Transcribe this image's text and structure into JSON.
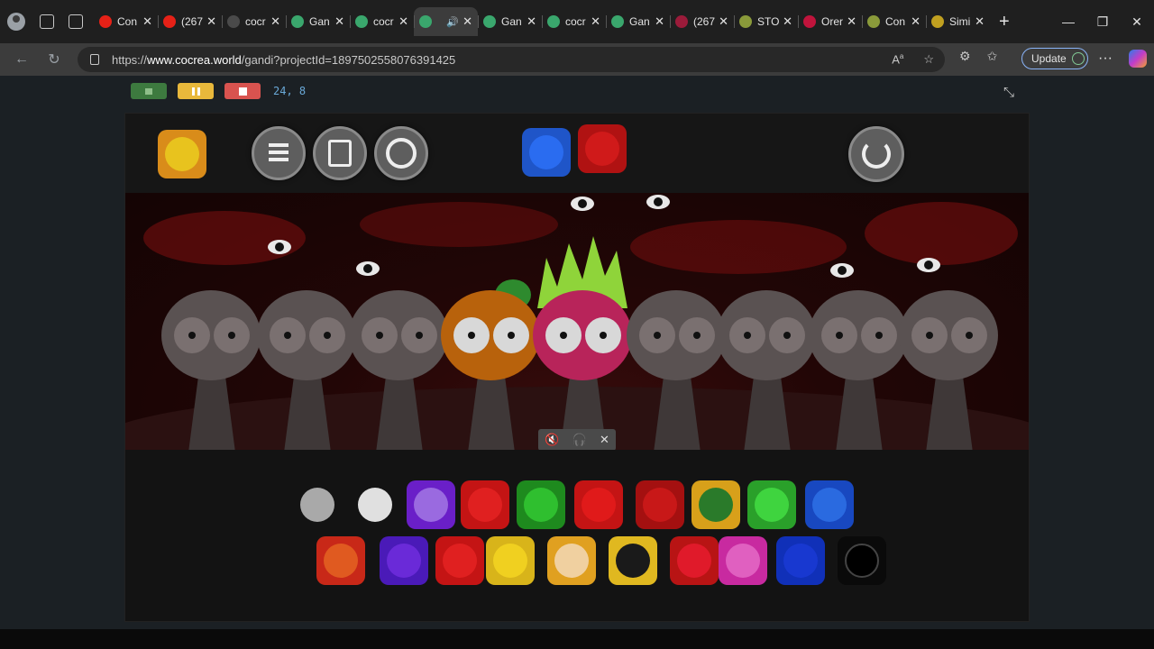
{
  "browser": {
    "tabs": [
      {
        "label": "Con",
        "color": "#e62117",
        "active": false
      },
      {
        "label": "(267",
        "color": "#e62117",
        "active": false
      },
      {
        "label": "cocr",
        "color": "#4a4a4a",
        "active": false
      },
      {
        "label": "Gan",
        "color": "#3aa76d",
        "active": false
      },
      {
        "label": "cocr",
        "color": "#3aa76d",
        "active": false
      },
      {
        "label": "",
        "color": "#3aa76d",
        "active": true
      },
      {
        "label": "Gan",
        "color": "#3aa76d",
        "active": false
      },
      {
        "label": "cocr",
        "color": "#3aa76d",
        "active": false
      },
      {
        "label": "Gan",
        "color": "#3aa76d",
        "active": false
      },
      {
        "label": "(267",
        "color": "#9b1b3a",
        "active": false
      },
      {
        "label": "STOI",
        "color": "#8a9a3a",
        "active": false
      },
      {
        "label": "Orer",
        "color": "#c0143c",
        "active": false
      },
      {
        "label": "Con",
        "color": "#8a9a3a",
        "active": false
      },
      {
        "label": "Simi",
        "color": "#c0a020",
        "active": false
      }
    ],
    "new_tab": "+",
    "url_prefix": "https://",
    "url_host": "www.cocrea.world",
    "url_path": "/gandi?projectId=1897502558076391425",
    "update_label": "Update",
    "menu_dots": "···"
  },
  "player": {
    "coords": "24, 8"
  },
  "scene": {
    "accent": "#c81414",
    "characters": [
      "grey",
      "grey",
      "grey",
      "orange",
      "dragonfruit",
      "grey",
      "grey",
      "grey",
      "grey"
    ]
  },
  "palette": {
    "row1": [
      "grey-shape",
      "white-flame",
      "purple-pot",
      "red-tomato",
      "watermelon",
      "cherry",
      "red-plain",
      "pineapple",
      "green-apple",
      "blueberry"
    ],
    "row2": [
      "orange-pumpkin",
      "plum",
      "red-apple",
      "lemon",
      "hat-face",
      "star",
      "strawberry",
      "pink-fruit",
      "blue-plain",
      "black-hole"
    ]
  }
}
